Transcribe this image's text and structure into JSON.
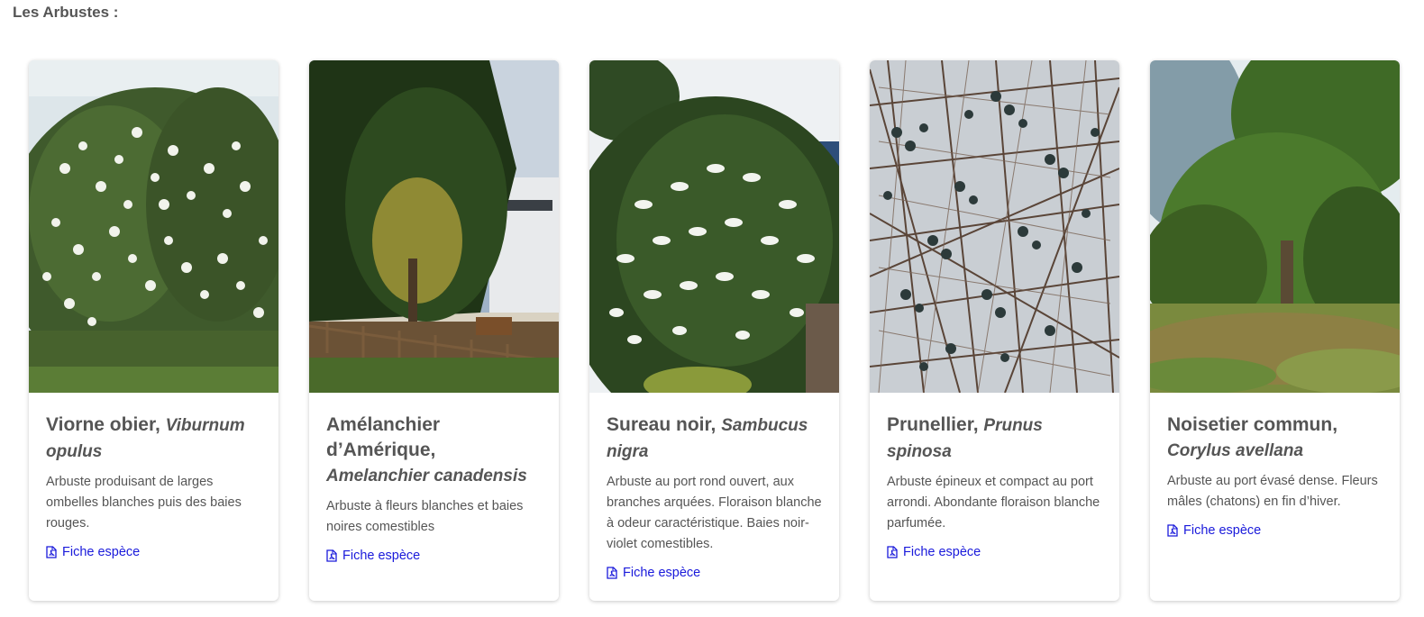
{
  "section": {
    "title": "Les Arbustes :"
  },
  "cards": [
    {
      "common_name": "Viorne obier,",
      "latin_name": "Viburnum opulus",
      "description": "Arbuste produisant de larges ombelles blanches puis des baies rouges.",
      "link_label": "Fiche espèce",
      "link_icon": "file-pdf-icon"
    },
    {
      "common_name": "Amélanchier d’Amérique,",
      "latin_name": "Amelanchier canadensis",
      "description": "Arbuste à fleurs blanches et baies noires comestibles",
      "link_label": "Fiche espèce",
      "link_icon": "file-pdf-icon"
    },
    {
      "common_name": "Sureau noir,",
      "latin_name": "Sambucus nigra",
      "description": "Arbuste au port rond ouvert, aux branches arquées. Floraison blanche à odeur caractéristique. Baies noir-violet comestibles.",
      "link_label": "Fiche espèce",
      "link_icon": "file-pdf-icon"
    },
    {
      "common_name": "Prunellier,",
      "latin_name": "Prunus spinosa",
      "description": "Arbuste épineux et compact au port arrondi. Abondante floraison blanche parfumée.",
      "link_label": "Fiche espèce",
      "link_icon": "file-pdf-icon"
    },
    {
      "common_name": "Noisetier commun,",
      "latin_name": "Corylus avellana",
      "description": "Arbuste au port évasé dense. Fleurs mâles (chatons) en fin d’hiver.",
      "link_label": "Fiche espèce",
      "link_icon": "file-pdf-icon"
    }
  ],
  "colors": {
    "link": "#1a1adb",
    "text": "#555555"
  }
}
